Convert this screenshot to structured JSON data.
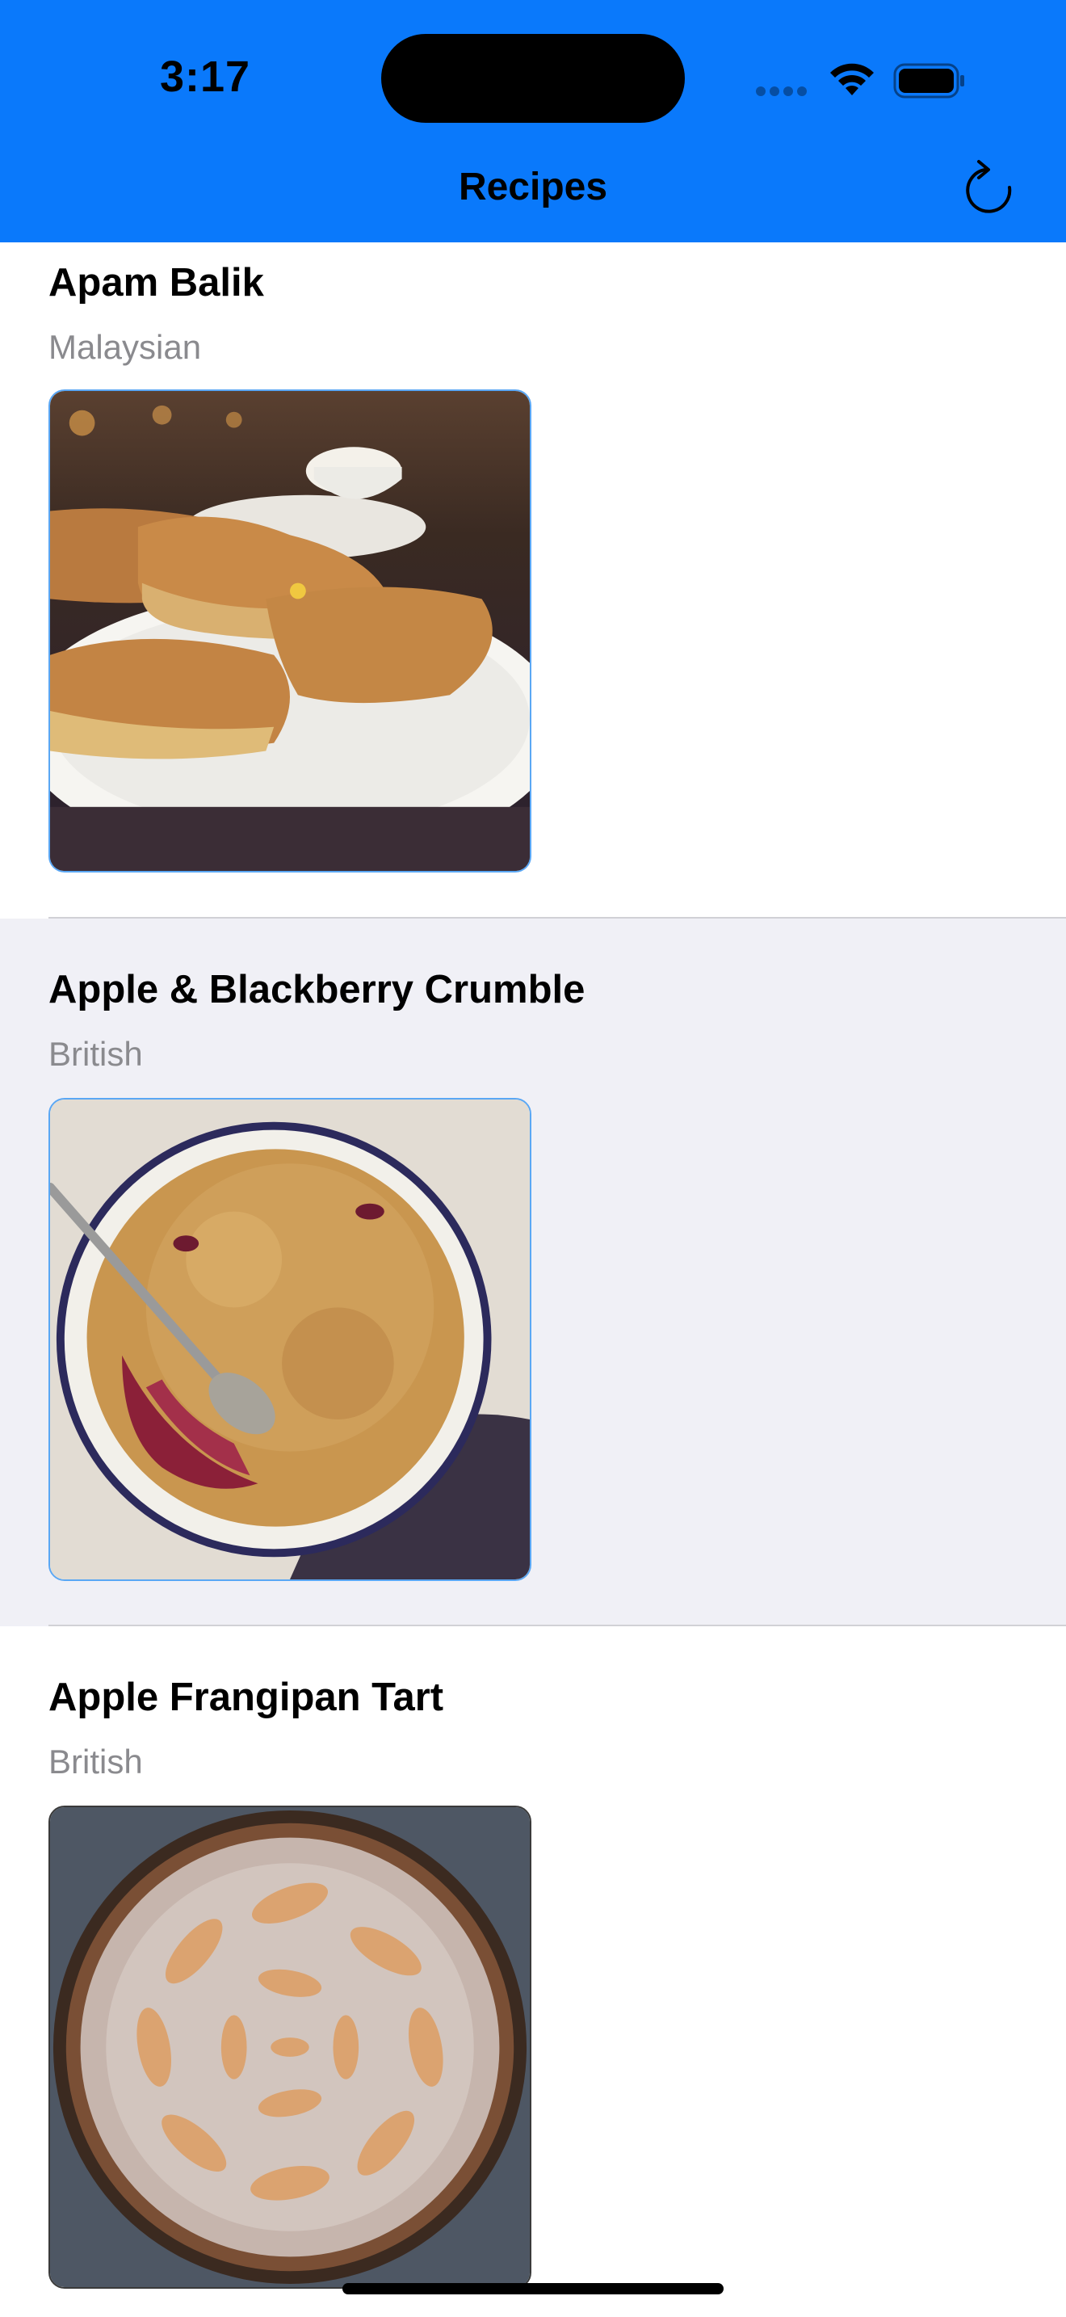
{
  "status_bar": {
    "time": "3:17",
    "icons": [
      "signal-dots-icon",
      "wifi-icon",
      "battery-icon"
    ]
  },
  "nav": {
    "title": "Recipes",
    "refresh_icon": "refresh-icon"
  },
  "recipes": [
    {
      "name": "Apam Balik",
      "cuisine": "Malaysian",
      "image": "apam-balik-photo"
    },
    {
      "name": "Apple & Blackberry Crumble",
      "cuisine": "British",
      "image": "apple-blackberry-crumble-photo"
    },
    {
      "name": "Apple Frangipan Tart",
      "cuisine": "British",
      "image": "apple-frangipan-tart-photo"
    }
  ],
  "colors": {
    "header_bg": "#0a79fb",
    "selected_row_bg": "#f0f0f6",
    "subtitle": "#8a8a8e"
  }
}
